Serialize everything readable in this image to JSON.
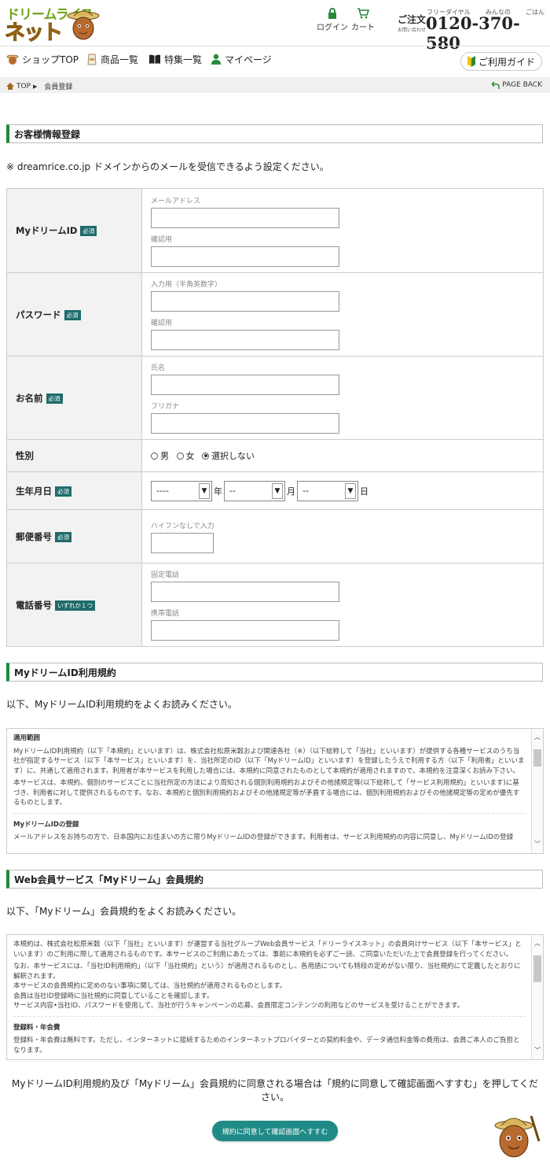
{
  "header": {
    "logo_line1": "ドリームライス",
    "logo_line2": "ネット",
    "login_label": "ログイン",
    "cart_label": "カート",
    "order_label": "ご注文",
    "order_sub": "お問い合わせ",
    "free_dial": "フリーダイヤル",
    "minnano": "みんなの",
    "gohan": "ごはん",
    "phone": "0120-370-580"
  },
  "nav": {
    "items": [
      {
        "label": "ショップTOP"
      },
      {
        "label": "商品一覧"
      },
      {
        "label": "特集一覧"
      },
      {
        "label": "マイページ"
      }
    ],
    "guide": "ご利用ガイド"
  },
  "breadcrumb": {
    "top": "TOP",
    "current": "会員登録",
    "page_back": "PAGE BACK"
  },
  "section1": {
    "title": "お客様情報登録",
    "note": "※ dreamrice.co.jp ドメインからのメールを受信できるよう設定ください。"
  },
  "form": {
    "required_label": "必須",
    "either_label": "いずれか１つ",
    "myid": {
      "label": "MyドリームID",
      "f1": "メールアドレス",
      "f2": "確認用"
    },
    "password": {
      "label": "パスワード",
      "f1": "入力用（半角英数字）",
      "f2": "確認用"
    },
    "name": {
      "label": "お名前",
      "f1": "氏名",
      "f2": "フリガナ"
    },
    "gender": {
      "label": "性別",
      "options": [
        "男",
        "女",
        "選択しない"
      ],
      "selected": "選択しない"
    },
    "birthday": {
      "label": "生年月日",
      "year_value": "----",
      "month_value": "--",
      "day_value": "--",
      "year_unit": "年",
      "month_unit": "月",
      "day_unit": "日"
    },
    "postal": {
      "label": "郵便番号",
      "f1": "ハイフンなしで入力"
    },
    "phone": {
      "label": "電話番号",
      "f1": "固定電話",
      "f2": "携帯電話"
    }
  },
  "section2": {
    "title": "MyドリームID利用規約",
    "note": "以下、MyドリームID利用規約をよくお読みください。",
    "h1": "適用範囲",
    "p1": "MyドリームID利用規約（以下「本規約」といいます）は、株式会社松原米穀および関連各社（※）（以下総称して「当社」といいます）が提供する各種サービスのうち当社が指定するサービス（以下「本サービス」といいます）を、当社所定のID（以下「MyドリームID」といいます）を登録したうえで利用する方（以下「利用者」といいます）に、共通して適用されます。利用者が本サービスを利用した場合には、本規約に同意されたものとして本規約が適用されますので、本規約を注意深くお読み下さい。",
    "p2": "本サービスは、本規約、個別のサービスごとに当社所定の方法により周知される個別利用規約およびその他諸規定等(以下総称して「サービス利用規約」といいます)に基づき、利用者に対して提供されるものです。なお、本規約と個別利用規約およびその他諸規定等が矛盾する場合には、個別利用規約およびその他諸規定等の定めが優先するものとします。",
    "h2": "MyドリームIDの登録",
    "p3": "メールアドレスをお持ちの方で、日本国内にお住まいの方に限りMyドリームIDの登録ができます。利用者は、サービス利用規約の内容に同意し、MyドリームIDの登録"
  },
  "section3": {
    "title": "Web会員サービス「Myドリーム」会員規約",
    "note": "以下、「Myドリーム」会員規約をよくお読みください。",
    "p1": "本規約は、株式会社松原米穀（以下「当社」といいます）が運営する当社グループWeb会員サービス「ドリーライスネット」の会員向けサービス（以下「本サービス」といいます）のご利用に際して適用されるものです。本サービスのご利用にあたっては、事前に本規約を必ずご一読、ご同意いただいた上で会員登録を行ってください。",
    "p2": "なお、本サービスには、「当社ID利用規約」（以下「当社規約」という）が適用されるものとし、各用語についても特段の定めがない限り、当社規約にて定義したとおりに解釈されます。",
    "p3": "本サービスの会員規約に定めのない事項に関しては、当社規約が適用されるものとします。",
    "p4": "会員は当社ID登録時に当社規約に同意していることを確認します。",
    "p5": "サービス内容•当社ID、パスワードを使用して、当社が行うキャンペーンの応募、会員限定コンテンツの利用などのサービスを受けることができます。",
    "h2": "登録料・年会費",
    "p6": "登録料・年会費は無料です。ただし、インターネットに接続するためのインターネットプロバイダーとの契約料金や、データ通信料金等の費用は、会員ご本人のご負担となります。"
  },
  "footer": {
    "agree_text": "MyドリームID利用規約及び「Myドリーム」会員規約に同意される場合は「規約に同意して確認画面へすすむ」を押してください。",
    "submit_label": "規約に同意して確認画面へすすむ"
  },
  "colors": {
    "accent": "#1d8a3c",
    "button": "#1f8a86",
    "badge": "#1f6b6b"
  }
}
